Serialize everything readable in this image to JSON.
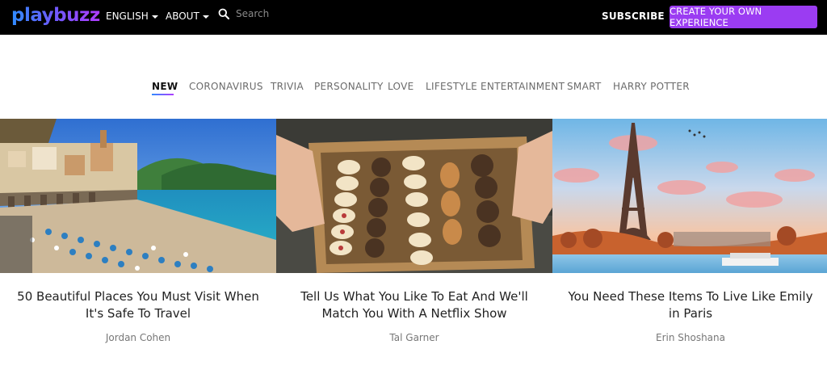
{
  "header": {
    "logo": "playbuzz",
    "language_label": "ENGLISH",
    "about_label": "ABOUT",
    "search_placeholder": "Search",
    "subscribe_label": "SUBSCRIBE",
    "cta_label": "CREATE YOUR OWN EXPERIENCE"
  },
  "tabs": [
    {
      "label": "NEW",
      "active": true
    },
    {
      "label": "CORONAVIRUS",
      "active": false
    },
    {
      "label": "TRIVIA",
      "active": false
    },
    {
      "label": "PERSONALITY",
      "active": false
    },
    {
      "label": "LOVE",
      "active": false
    },
    {
      "label": "LIFESTYLE",
      "active": false
    },
    {
      "label": "ENTERTAINMENT",
      "active": false
    },
    {
      "label": "SMART",
      "active": false
    },
    {
      "label": "HARRY POTTER",
      "active": false
    }
  ],
  "cards": [
    {
      "title": "50 Beautiful Places You Must Visit When It's Safe To Travel",
      "author": "Jordan Cohen",
      "image": "coastal-town-beach-photo"
    },
    {
      "title": "Tell Us What You Like To Eat And We'll Match You With A Netflix Show",
      "author": "Tal Garner",
      "image": "box-of-cookies-photo"
    },
    {
      "title": "You Need These Items To Live Like Emily in Paris",
      "author": "Erin Shoshana",
      "image": "eiffel-tower-sunset-photo"
    }
  ],
  "colors": {
    "topbar_bg": "#000000",
    "cta_bg": "#9b3cf2",
    "logo_gradient": [
      "#2f8cff",
      "#b03cff"
    ]
  }
}
